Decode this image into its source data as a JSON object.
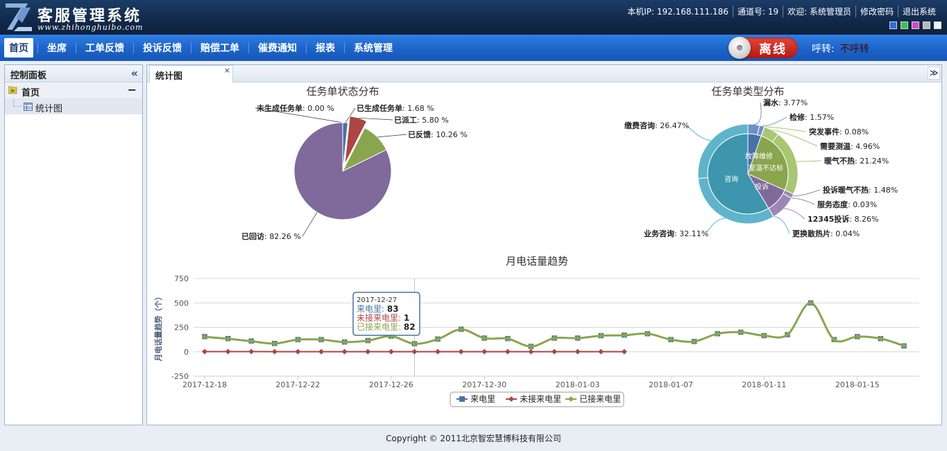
{
  "header": {
    "title": "客服管理系统",
    "url": "www.zhihonghuibo.com",
    "ip": "本机IP: 192.168.111.186",
    "channel": "通道号: 19",
    "welcome": "欢迎: 系统管理员",
    "change_password": "修改密码",
    "logout": "退出系统",
    "skin_colors": [
      "#2f6fd6",
      "#39c24a",
      "#d04ac9",
      "#b7b7b7",
      "#f2f2f2"
    ]
  },
  "nav": {
    "items": [
      "首页",
      "坐席",
      "工单反馈",
      "投诉反馈",
      "赔偿工单",
      "催费通知",
      "报表",
      "系统管理"
    ],
    "active_index": 0,
    "status_label": "离线",
    "transfer_label": "呼转:",
    "transfer_value": "不呼转"
  },
  "sidebar": {
    "title": "控制面板",
    "root_label": "首页",
    "child_label": "统计图"
  },
  "tab": {
    "label": "统计图"
  },
  "footer": {
    "copyright": "Copyright © 2011北京智宏慧博科技有限公司"
  },
  "chart_data": [
    {
      "type": "pie",
      "title": "任务单状态分布",
      "slices": [
        {
          "label": "未生成任务单",
          "value": 0.0,
          "color": "#4572A7"
        },
        {
          "label": "已生成任务单",
          "value": 1.68,
          "color": "#4572A7"
        },
        {
          "label": "已派工",
          "value": 5.8,
          "color": "#AA4643"
        },
        {
          "label": "已反馈",
          "value": 10.26,
          "color": "#89A54E"
        },
        {
          "label": "已回访",
          "value": 82.26,
          "color": "#80699B"
        }
      ]
    },
    {
      "type": "pie",
      "title": "任务单类型分布",
      "inner": [
        {
          "label": "故障维修",
          "value": 5.34,
          "color": "#4572A7"
        },
        {
          "label": "室温不达标",
          "value": 26.28,
          "color": "#89A54E"
        },
        {
          "label": "投诉",
          "value": 9.77,
          "color": "#80699B"
        },
        {
          "label": "咨询",
          "value": 58.58,
          "color": "#3D96AE"
        }
      ],
      "outer": [
        {
          "label": "漏水",
          "value": 3.77,
          "color": "#6C8FC7"
        },
        {
          "label": "检修",
          "value": 1.57,
          "color": "#6C8FC7"
        },
        {
          "label": "突发事件",
          "value": 0.08,
          "color": "#A9C673"
        },
        {
          "label": "需要测温",
          "value": 4.96,
          "color": "#A9C673"
        },
        {
          "label": "暖气不热",
          "value": 21.24,
          "color": "#A9C673"
        },
        {
          "label": "投诉暖气不热",
          "value": 1.48,
          "color": "#9C86B8"
        },
        {
          "label": "服务态度",
          "value": 0.03,
          "color": "#9C86B8"
        },
        {
          "label": "12345投诉",
          "value": 8.26,
          "color": "#9C86B8"
        },
        {
          "label": "更换散热片",
          "value": 0.04,
          "color": "#5FB4CB"
        },
        {
          "label": "业务咨询",
          "value": 32.11,
          "color": "#5FB4CB"
        },
        {
          "label": "缴费咨询",
          "value": 26.47,
          "color": "#5FB4CB"
        }
      ]
    },
    {
      "type": "line",
      "title": "月电话量趋势",
      "ylabel": "月电话量趋势（个）",
      "ylim": [
        -250,
        750
      ],
      "yticks": [
        750,
        500,
        250,
        0,
        -250
      ],
      "xtick_labels": [
        "2017-12-18",
        "2017-12-22",
        "2017-12-26",
        "2017-12-30",
        "2018-01-03",
        "2018-01-07",
        "2018-01-11",
        "2018-01-15"
      ],
      "x": [
        "2017-12-18",
        "2017-12-19",
        "2017-12-20",
        "2017-12-21",
        "2017-12-22",
        "2017-12-23",
        "2017-12-24",
        "2017-12-25",
        "2017-12-26",
        "2017-12-27",
        "2017-12-28",
        "2017-12-29",
        "2017-12-30",
        "2017-12-31",
        "2018-01-01",
        "2018-01-02",
        "2018-01-03",
        "2018-01-04",
        "2018-01-05",
        "2018-01-06",
        "2018-01-07",
        "2018-01-08",
        "2018-01-09",
        "2018-01-10",
        "2018-01-11",
        "2018-01-12",
        "2018-01-13",
        "2018-01-14",
        "2018-01-15",
        "2018-01-16",
        "2018-01-17",
        "2018-01-18"
      ],
      "series": [
        {
          "name": "来电里",
          "color": "#4572A7",
          "marker": "square",
          "values": [
            155,
            135,
            110,
            85,
            125,
            125,
            100,
            115,
            160,
            83,
            130,
            230,
            140,
            135,
            55,
            140,
            140,
            165,
            170,
            185,
            125,
            105,
            185,
            200,
            165,
            175,
            500,
            125,
            155,
            135,
            60,
            null
          ]
        },
        {
          "name": "未接来电里",
          "color": "#AA4643",
          "marker": "diamond",
          "values": [
            2,
            2,
            2,
            1,
            1,
            1,
            1,
            1,
            1,
            1,
            1,
            1,
            1,
            1,
            1,
            1,
            1,
            1,
            1,
            null,
            null,
            null,
            null,
            null,
            null,
            null,
            null,
            null,
            null,
            null,
            null,
            null
          ]
        },
        {
          "name": "已接来电里",
          "color": "#89A54E",
          "marker": "circle",
          "values": [
            153,
            133,
            108,
            84,
            124,
            124,
            99,
            114,
            159,
            82,
            129,
            229,
            139,
            134,
            54,
            139,
            139,
            164,
            169,
            185,
            125,
            105,
            185,
            200,
            165,
            175,
            500,
            125,
            155,
            135,
            60,
            null
          ]
        }
      ],
      "tooltip": {
        "date": "2017-12-27",
        "rows": [
          {
            "label": "来电里: ",
            "value": "83"
          },
          {
            "label": "未接来电里: ",
            "value": "1"
          },
          {
            "label": "已接来电里: ",
            "value": "82"
          }
        ]
      },
      "legend": [
        "来电里",
        "未接来电里",
        "已接来电里"
      ]
    }
  ]
}
